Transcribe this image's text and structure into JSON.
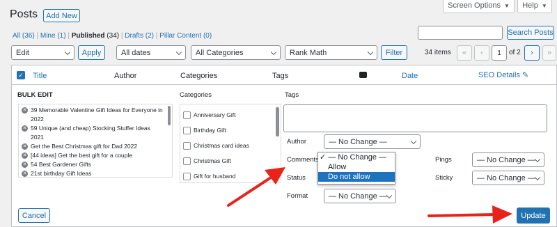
{
  "page_title": "Posts",
  "add_new": "Add New",
  "screen_options": "Screen Options",
  "help": "Help",
  "filters": {
    "all": "All",
    "all_count": "(36)",
    "mine": "Mine",
    "mine_count": "(1)",
    "published": "Published",
    "published_count": "(34)",
    "drafts": "Drafts",
    "drafts_count": "(2)",
    "pillar": "Pillar Content",
    "pillar_count": "(0)",
    "sep": "|"
  },
  "search_button": "Search Posts",
  "toolbar": {
    "bulk_action": "Edit",
    "apply": "Apply",
    "dates": "All dates",
    "categories": "All Categories",
    "rank_math": "Rank Math",
    "filter": "Filter",
    "items": "34 items",
    "first": "«",
    "prev": "‹",
    "page": "1",
    "of_pages": "of 2",
    "next": "›",
    "last": "»"
  },
  "table_header": {
    "title": "Title",
    "author": "Author",
    "categories": "Categories",
    "tags": "Tags",
    "date": "Date",
    "seo": "SEO Details"
  },
  "bulk": {
    "heading": "BULK EDIT",
    "posts": [
      "39 Memorable Valentine Gift Ideas for Everyone in",
      "2022",
      "59 Unique (and cheap) Stocking Stuffer Ideas",
      "2021",
      "Get the Best Christmas gift for Dad 2022",
      "[44 ideas] Get the best gift for a couple",
      "54 Best Gardener Gifts",
      "21st birthday Gift Ideas"
    ],
    "categories_label": "Categories",
    "categories": [
      "Anniversary Gift",
      "Birthday Gift",
      "Christmas card ideas",
      "Christmas Gift",
      "Gift for husband"
    ],
    "tags_label": "Tags",
    "author_label": "Author",
    "author_value": "— No Change —",
    "comments_label": "Comments",
    "comments_selected": "✓ — No Change —",
    "comments_options": [
      "Allow",
      "Do not allow"
    ],
    "status_label": "Status",
    "format_label": "Format",
    "format_value": "— No Change —",
    "pings_label": "Pings",
    "pings_value": "— No Change —",
    "sticky_label": "Sticky",
    "sticky_value": "— No Change —",
    "cancel": "Cancel",
    "update": "Update"
  },
  "colors": {
    "accent": "#2271b1",
    "arrow": "#e8231a",
    "highlight": "#1e73be"
  }
}
